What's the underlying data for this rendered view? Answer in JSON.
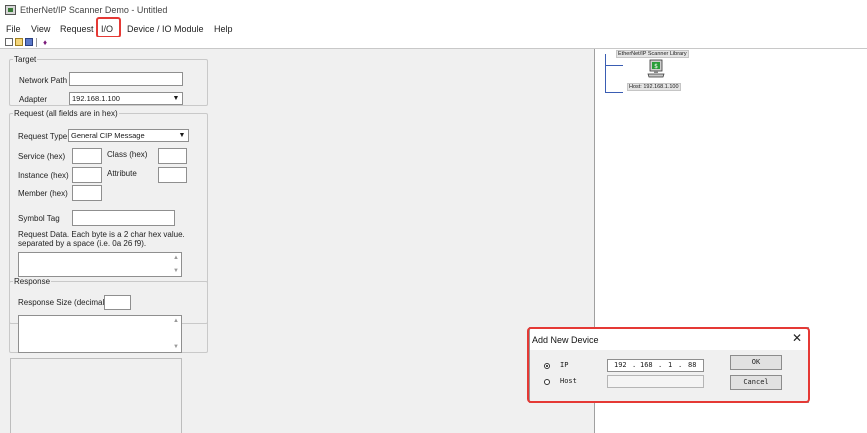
{
  "window": {
    "title": "EtherNet/IP Scanner Demo - Untitled"
  },
  "menu": {
    "file": "File",
    "view": "View",
    "request": "Request",
    "io": "I/O",
    "device_io_module": "Device / IO Module",
    "help": "Help"
  },
  "toolbar": {
    "icons": [
      "new-icon",
      "open-icon",
      "save-icon",
      "about-icon"
    ]
  },
  "target": {
    "legend": "Target",
    "network_path_label": "Network Path",
    "network_path_value": "",
    "adapter_label": "Adapter",
    "adapter_value": "192.168.1.100"
  },
  "request": {
    "legend": "Request (all fields are in hex)",
    "request_type_label": "Request Type",
    "request_type_value": "General CIP Message",
    "service_label": "Service (hex)",
    "class_label": "Class (hex)",
    "instance_label": "Instance (hex)",
    "attribute_label": "Attribute",
    "member_label": "Member (hex)",
    "symbol_tag_label": "Symbol Tag",
    "request_data_label_1": "Request Data. Each byte is a 2 char hex value.",
    "request_data_label_2": "separated by a space (i.e. 0a 26 f9)."
  },
  "response": {
    "legend": "Response",
    "response_size_label": "Response Size (decimal)"
  },
  "tree": {
    "root": "EtherNet/IP Scanner Library",
    "host": "Host: 192.168.1.100"
  },
  "dialog": {
    "title": "Add New Device",
    "ip_label": "IP",
    "host_label": "Host",
    "ip_octets": [
      "192",
      "168",
      "1",
      "88"
    ],
    "ip_dot": ".",
    "ok_label": "OK",
    "cancel_label": "Cancel",
    "close_glyph": "✕",
    "selected_option": "IP"
  },
  "colors": {
    "highlight": "#e53935",
    "tree_line": "#3a5db3",
    "monitor": "#2a9d3a"
  }
}
